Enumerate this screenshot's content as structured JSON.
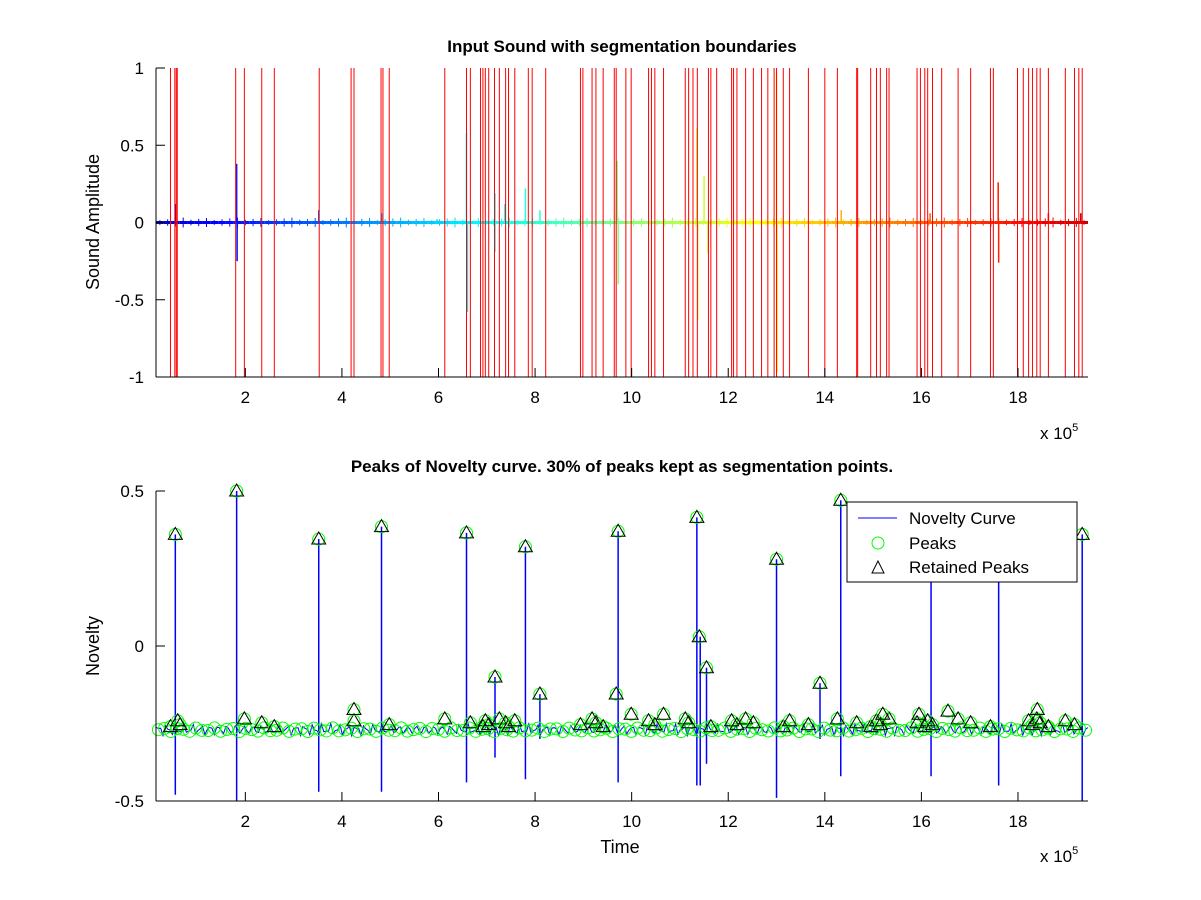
{
  "chart_data": [
    {
      "type": "line",
      "title": "Input Sound with segmentation boundaries",
      "xlabel": "",
      "ylabel": "Sound Amplitude",
      "x_multiplier": "x 10",
      "x_multiplier_exp": "5",
      "xlim": [
        0.15,
        19.45
      ],
      "ylim": [
        -1,
        1
      ],
      "xticks": [
        2,
        4,
        6,
        8,
        10,
        12,
        14,
        16,
        18
      ],
      "xtick_labels": [
        "2",
        "4",
        "6",
        "8",
        "10",
        "12",
        "14",
        "16",
        "18"
      ],
      "yticks": [
        -1,
        -0.5,
        0,
        0.5,
        1
      ],
      "ytick_labels": [
        "-1",
        "-0.5",
        "0",
        "0.5",
        "1"
      ],
      "colormap": "jet (waveform colored from dark blue to dark red over time)",
      "boundary_color": "#ff0000",
      "segmentation_boundaries": [
        0.45,
        0.54,
        0.57,
        0.59,
        1.8,
        1.98,
        2.34,
        2.6,
        3.53,
        4.19,
        4.25,
        4.81,
        4.85,
        4.98,
        6.13,
        6.58,
        6.66,
        6.87,
        6.92,
        6.97,
        7.04,
        7.16,
        7.26,
        7.39,
        7.45,
        7.58,
        7.86,
        7.94,
        8.22,
        8.94,
        8.99,
        9.18,
        9.26,
        9.41,
        9.64,
        9.68,
        9.88,
        9.99,
        10.35,
        10.41,
        10.48,
        10.66,
        11.11,
        11.18,
        11.27,
        11.36,
        11.59,
        11.64,
        11.76,
        12.07,
        12.11,
        12.18,
        12.36,
        12.52,
        12.69,
        12.82,
        12.95,
        13.0,
        13.14,
        13.27,
        13.66,
        14.0,
        14.26,
        14.66,
        14.68,
        14.95,
        15.07,
        15.15,
        15.28,
        15.33,
        15.91,
        15.98,
        16.07,
        16.13,
        16.23,
        16.42,
        16.76,
        17.02,
        17.43,
        17.49,
        17.99,
        18.11,
        18.22,
        18.3,
        18.39,
        18.46,
        18.63,
        18.98,
        19.17,
        19.26,
        19.33
      ],
      "waveform_bursts": [
        {
          "x": 0.55,
          "amp": 0.12
        },
        {
          "x": 1.82,
          "amp": 0.38
        },
        {
          "x": 1.83,
          "amp": -0.25
        },
        {
          "x": 3.52,
          "amp": 0.08
        },
        {
          "x": 4.82,
          "amp": 0.06
        },
        {
          "x": 5.97,
          "amp": 0.02
        },
        {
          "x": 6.58,
          "amp": 0.58
        },
        {
          "x": 6.6,
          "amp": -0.58
        },
        {
          "x": 7.17,
          "amp": 0.19
        },
        {
          "x": 7.17,
          "amp": -0.19
        },
        {
          "x": 7.37,
          "amp": 0.12
        },
        {
          "x": 7.8,
          "amp": 0.22
        },
        {
          "x": 8.1,
          "amp": 0.08
        },
        {
          "x": 9.7,
          "amp": 0.4
        },
        {
          "x": 9.72,
          "amp": -0.4
        },
        {
          "x": 11.35,
          "amp": 0.61
        },
        {
          "x": 11.37,
          "amp": -0.63
        },
        {
          "x": 11.5,
          "amp": 0.3
        },
        {
          "x": 11.58,
          "amp": -0.2
        },
        {
          "x": 13.0,
          "amp": 0.97
        },
        {
          "x": 13.01,
          "amp": -0.97
        },
        {
          "x": 14.34,
          "amp": 0.08
        },
        {
          "x": 16.18,
          "amp": 0.06
        },
        {
          "x": 17.59,
          "amp": 0.26
        },
        {
          "x": 17.6,
          "amp": -0.26
        },
        {
          "x": 18.63,
          "amp": 0.06
        },
        {
          "x": 19.3,
          "amp": 0.06
        }
      ]
    },
    {
      "type": "line",
      "title": "Peaks of Novelty curve. 30% of peaks kept as segmentation points.",
      "xlabel": "Time",
      "ylabel": "Novelty",
      "x_multiplier": "x 10",
      "x_multiplier_exp": "5",
      "xlim": [
        0.15,
        19.45
      ],
      "ylim": [
        -0.5,
        0.5
      ],
      "xticks": [
        2,
        4,
        6,
        8,
        10,
        12,
        14,
        16,
        18
      ],
      "xtick_labels": [
        "2",
        "4",
        "6",
        "8",
        "10",
        "12",
        "14",
        "16",
        "18"
      ],
      "yticks": [
        -0.5,
        0,
        0.5
      ],
      "ytick_labels": [
        "-0.5",
        "0",
        "0.5"
      ],
      "legend": {
        "location": "top-right",
        "entries": [
          {
            "label": "Novelty Curve",
            "marker": "line",
            "color": "#0000ff"
          },
          {
            "label": "Peaks",
            "marker": "circle",
            "color": "#00ff00"
          },
          {
            "label": "Retained Peaks",
            "marker": "triangle",
            "color": "#000000"
          }
        ]
      },
      "baseline": -0.27,
      "series": [
        {
          "name": "Retained Peaks",
          "x": [
            0.55,
            1.82,
            3.52,
            4.82,
            6.58,
            7.8,
            9.72,
            11.35,
            13.0,
            14.33,
            19.33,
            7.17,
            8.1,
            9.68,
            11.4,
            11.55,
            13.9,
            4.25,
            9.99,
            10.66,
            15.2,
            16.55,
            15.95,
            18.4
          ],
          "y": [
            0.36,
            0.5,
            0.345,
            0.385,
            0.365,
            0.32,
            0.37,
            0.415,
            0.28,
            0.47,
            0.36,
            -0.1,
            -0.155,
            -0.155,
            0.03,
            -0.07,
            -0.12,
            -0.205,
            -0.22,
            -0.22,
            -0.22,
            -0.21,
            -0.22,
            -0.205
          ]
        }
      ],
      "novelty_spikes": [
        {
          "x": 0.55,
          "max": 0.36,
          "min": -0.48
        },
        {
          "x": 1.82,
          "max": 0.5,
          "min": -0.5
        },
        {
          "x": 3.52,
          "max": 0.345,
          "min": -0.47
        },
        {
          "x": 4.82,
          "max": 0.385,
          "min": -0.47
        },
        {
          "x": 6.58,
          "max": 0.365,
          "min": -0.44
        },
        {
          "x": 7.17,
          "max": -0.1,
          "min": -0.36
        },
        {
          "x": 7.8,
          "max": 0.32,
          "min": -0.43
        },
        {
          "x": 8.1,
          "max": -0.155,
          "min": -0.3
        },
        {
          "x": 9.72,
          "max": 0.37,
          "min": -0.44
        },
        {
          "x": 11.35,
          "max": 0.415,
          "min": -0.45
        },
        {
          "x": 11.42,
          "max": 0.03,
          "min": -0.45
        },
        {
          "x": 11.55,
          "max": -0.07,
          "min": -0.38
        },
        {
          "x": 13.0,
          "max": 0.28,
          "min": -0.49
        },
        {
          "x": 13.9,
          "max": -0.12,
          "min": -0.3
        },
        {
          "x": 14.33,
          "max": 0.47,
          "min": -0.42
        },
        {
          "x": 16.2,
          "max": 0.3,
          "min": -0.42
        },
        {
          "x": 17.6,
          "max": 0.3,
          "min": -0.45
        },
        {
          "x": 19.33,
          "max": 0.36,
          "min": -0.5
        }
      ]
    }
  ]
}
